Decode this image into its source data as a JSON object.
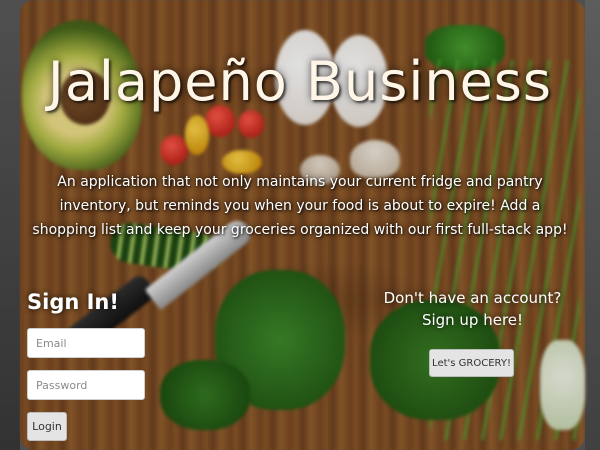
{
  "app": {
    "title": "Jalapeño Business",
    "tagline": "An application that not only maintains your current fridge and pantry inventory, but reminds you when your food is about to expire! Add a shopping list and keep your groceries organized with our first full-stack app!"
  },
  "signin": {
    "heading": "Sign In!",
    "email_placeholder": "Email",
    "password_placeholder": "Password",
    "email_value": "",
    "password_value": "",
    "login_label": "Login"
  },
  "signup": {
    "line1": "Don't have an account?",
    "line2": "Sign up here!",
    "button_label": "Let's GROCERY!"
  },
  "background": {
    "description_icon": "cutting-board-with-vegetables-photo"
  }
}
